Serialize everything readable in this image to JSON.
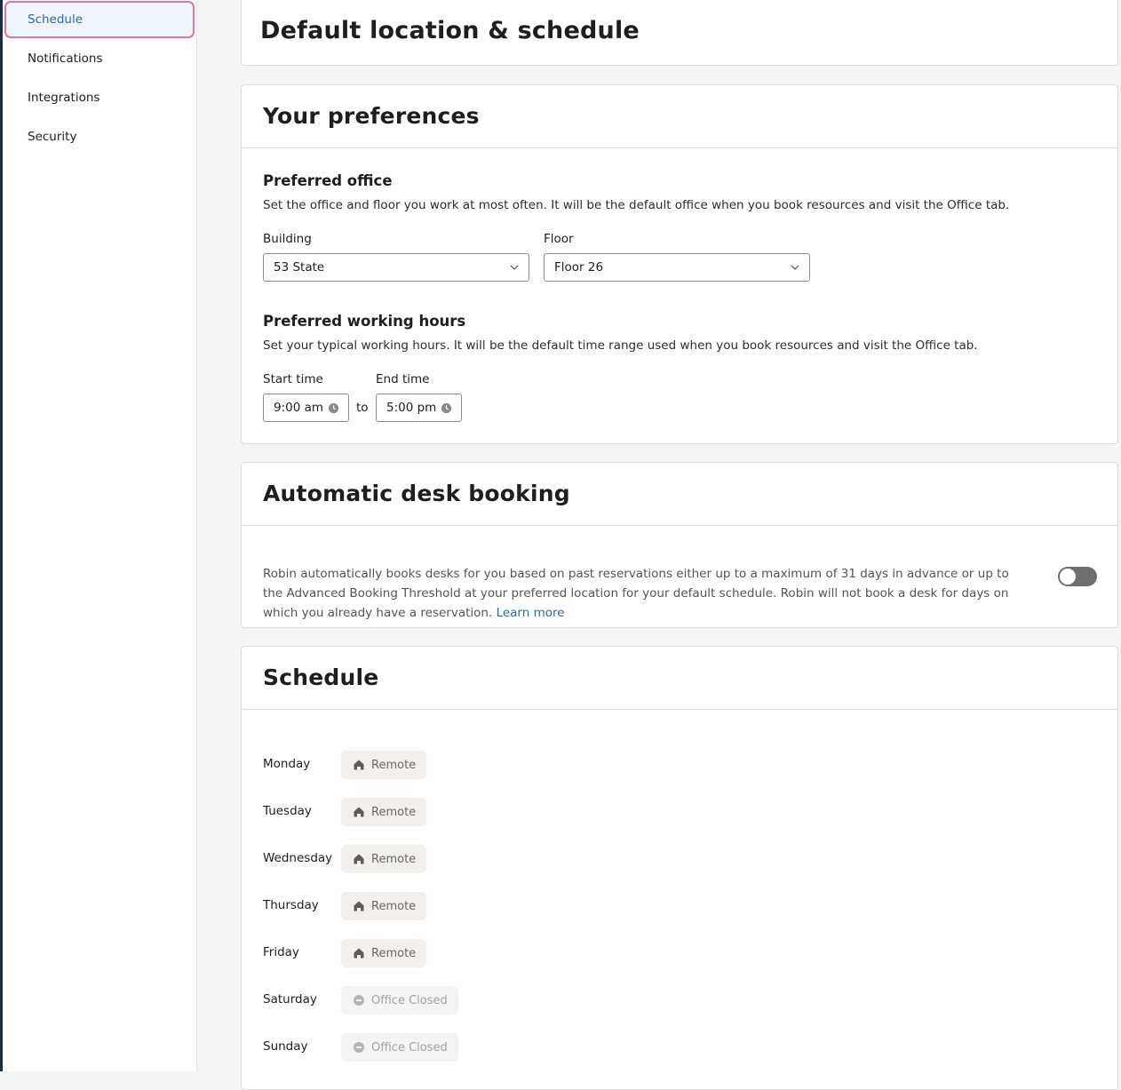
{
  "sidebar": {
    "items": [
      {
        "label": "Schedule",
        "active": true
      },
      {
        "label": "Notifications",
        "active": false
      },
      {
        "label": "Integrations",
        "active": false
      },
      {
        "label": "Security",
        "active": false
      }
    ]
  },
  "header": {
    "title": "Default location & schedule"
  },
  "preferences": {
    "title": "Your preferences",
    "office": {
      "title": "Preferred office",
      "description": "Set the office and floor you work at most often. It will be the default office when you book resources and visit the Office tab.",
      "building_label": "Building",
      "building_value": "53 State",
      "floor_label": "Floor",
      "floor_value": "Floor 26"
    },
    "hours": {
      "title": "Preferred working hours",
      "description": "Set your typical working hours. It will be the default time range used when you book resources and visit the Office tab.",
      "start_label": "Start time",
      "start_value": "9:00 am",
      "separator": "to",
      "end_label": "End time",
      "end_value": "5:00 pm"
    }
  },
  "auto_booking": {
    "title": "Automatic desk booking",
    "description": "Robin automatically books desks for you based on past reservations either up to a maximum of 31 days in advance or up to the Advanced Booking Threshold at your preferred location for your default schedule. Robin will not book a desk for days on which you already have a reservation.",
    "link_text": "Learn more",
    "enabled": false
  },
  "schedule": {
    "title": "Schedule",
    "days": [
      {
        "day": "Monday",
        "status": "Remote",
        "icon": "home-icon"
      },
      {
        "day": "Tuesday",
        "status": "Remote",
        "icon": "home-icon"
      },
      {
        "day": "Wednesday",
        "status": "Remote",
        "icon": "home-icon"
      },
      {
        "day": "Thursday",
        "status": "Remote",
        "icon": "home-icon"
      },
      {
        "day": "Friday",
        "status": "Remote",
        "icon": "home-icon"
      },
      {
        "day": "Saturday",
        "status": "Office Closed",
        "icon": "minus-circle-icon"
      },
      {
        "day": "Sunday",
        "status": "Office Closed",
        "icon": "minus-circle-icon"
      }
    ]
  },
  "colors": {
    "accent": "#2a6bb3",
    "active_outline": "#d87aa1",
    "toggle_off": "#6f6f6f",
    "chip_bg": "#f2efec"
  }
}
